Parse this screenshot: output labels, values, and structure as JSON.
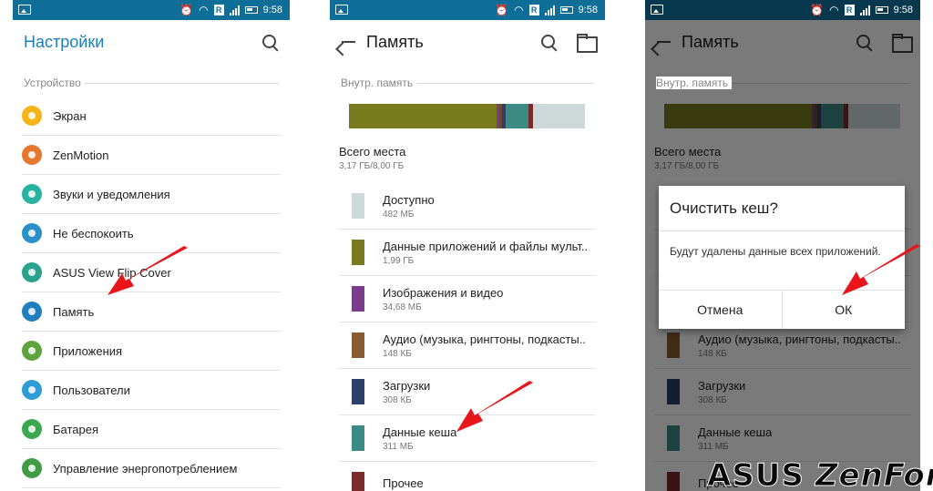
{
  "status": {
    "time": "9:58",
    "roaming": "R"
  },
  "settings": {
    "title": "Настройки",
    "section": "Устройство",
    "items": [
      {
        "label": "Экран",
        "color": "#f5b418"
      },
      {
        "label": "ZenMotion",
        "color": "#e6772e"
      },
      {
        "label": "Звуки и уведомления",
        "color": "#26b39f"
      },
      {
        "label": "Не беспокоить",
        "color": "#2d8fc9"
      },
      {
        "label": "ASUS View Flip Cover",
        "color": "#2aa38e"
      },
      {
        "label": "Память",
        "color": "#1f7fbf"
      },
      {
        "label": "Приложения",
        "color": "#5fa33c"
      },
      {
        "label": "Пользователи",
        "color": "#2d9bd6"
      },
      {
        "label": "Батарея",
        "color": "#3aa84f"
      },
      {
        "label": "Управление энергопотреблением",
        "color": "#3f9b45"
      }
    ]
  },
  "memory": {
    "title": "Память",
    "section": "Внутр. память",
    "bar": [
      {
        "pct": 62.5,
        "color": "#787a1e"
      },
      {
        "pct": 1.2,
        "color": "#7a3d8c"
      },
      {
        "pct": 1.2,
        "color": "#6a4a2a"
      },
      {
        "pct": 1.5,
        "color": "#2b3f6a"
      },
      {
        "pct": 9.5,
        "color": "#3c8a84"
      },
      {
        "pct": 2.3,
        "color": "#7a2b2b"
      },
      {
        "pct": 21.8,
        "color": "#cdd8d9"
      }
    ],
    "total_label": "Всего места",
    "total_value": "3,17 ГБ/8,00 ГБ",
    "items": [
      {
        "name": "Доступно",
        "size": "482 МБ",
        "color": "#cdd8d9"
      },
      {
        "name": "Данные приложений и файлы мульт...",
        "size": "1,99 ГБ",
        "color": "#787a1e"
      },
      {
        "name": "Изображения и видео",
        "size": "34,68 МБ",
        "color": "#7a3d8c"
      },
      {
        "name": "Аудио (музыка, рингтоны, подкасты..",
        "size": "148 КБ",
        "color": "#8a5a30"
      },
      {
        "name": "Загрузки",
        "size": "308 КБ",
        "color": "#2b3f6a"
      },
      {
        "name": "Данные кеша",
        "size": "311 МБ",
        "color": "#3c8a84"
      },
      {
        "name": "Прочее",
        "size": "",
        "color": "#7a2b2b"
      }
    ]
  },
  "dialog": {
    "title": "Очистить кеш?",
    "message": "Будут удалены данные всех приложений.",
    "cancel": "Отмена",
    "ok": "ОК"
  },
  "logo": {
    "brand": "ASUS",
    "model": "ZenFone"
  },
  "colors": {
    "statusbar": "#0f6e97",
    "accent": "#1e7fb8",
    "arrow": "#e8161b"
  }
}
